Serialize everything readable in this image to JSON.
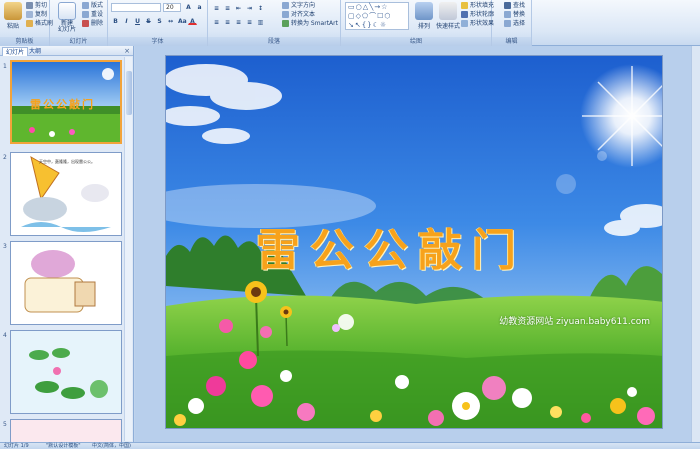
{
  "ribbon": {
    "clipboard": {
      "paste": "粘贴",
      "cut": "剪切",
      "copy": "复制",
      "format_painter": "格式刷",
      "label": "剪贴板"
    },
    "slides": {
      "new_slide": "新建",
      "new_slide2": "幻灯片",
      "layout": "版式",
      "reset": "重设",
      "delete": "删除",
      "label": "幻灯片"
    },
    "font": {
      "size": "20",
      "label": "字体"
    },
    "paragraph": {
      "text_direction": "文字方向",
      "align_text": "对齐文本",
      "smartart": "转换为 SmartArt",
      "label": "段落"
    },
    "drawing": {
      "arrange": "排列",
      "quick_styles": "快速样式",
      "shape_fill": "形状填充",
      "shape_outline": "形状轮廓",
      "shape_effects": "形状效果",
      "label": "绘图"
    },
    "editing": {
      "find": "查找",
      "replace": "替换",
      "select": "选择",
      "label": "编辑"
    }
  },
  "pane": {
    "tab_slides": "幻灯片",
    "tab_outline": "大纲",
    "close": "×",
    "thumbs": [
      {
        "num": "1",
        "title": "雷公公敲门"
      },
      {
        "num": "2",
        "text": "天空中，轰隆隆，出现雷公公。"
      },
      {
        "num": "3",
        "text": ""
      },
      {
        "num": "4",
        "text": ""
      },
      {
        "num": "5",
        "text": ""
      }
    ]
  },
  "slide": {
    "title": "雷公公敲门",
    "watermark": "幼教资源网站 ziyuan.baby611.com"
  },
  "status": {
    "slide_count": "幻灯片 1/9",
    "theme": "\"默认设计模板\"",
    "language": "中文(简体，中国)"
  }
}
